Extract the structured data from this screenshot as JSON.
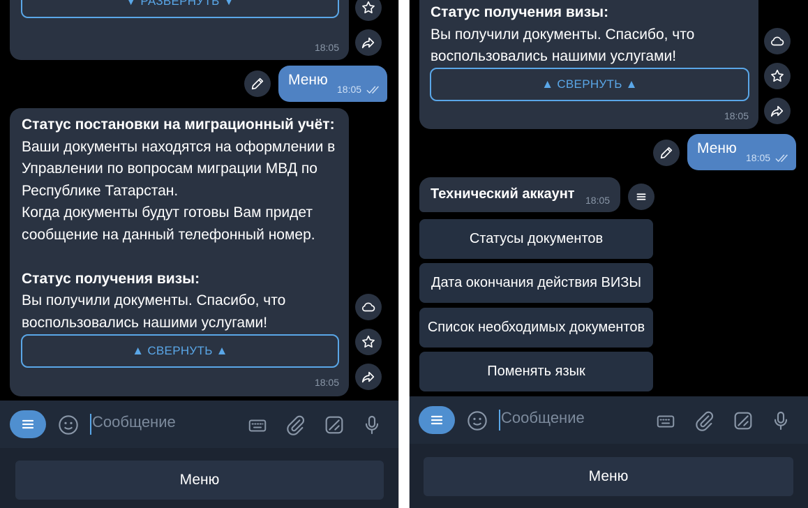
{
  "left": {
    "top_bubble": {
      "expand_label": "▼ РАЗВЕРНУТЬ ▼",
      "time": "18:05"
    },
    "user_msg": {
      "text": "Меню",
      "time": "18:05"
    },
    "status_bubble": {
      "migration_title": "Статус постановки на миграционный учёт:",
      "migration_lines": [
        "Ваши документы находятся на оформлении в",
        "Управлении по вопросам миграции МВД по",
        "Республике Татарстан.",
        "Когда документы будут готовы Вам придет",
        "сообщение на данный телефонный номер."
      ],
      "visa_title": "Статус получения визы:",
      "visa_lines": [
        "Вы получили документы. Спасибо, что",
        "воспользовались нашими услугами!"
      ],
      "collapse_label": "▲ СВЕРНУТЬ ▲",
      "time": "18:05"
    },
    "input": {
      "placeholder": "Сообщение"
    },
    "menu_button": "Меню"
  },
  "right": {
    "status_bubble": {
      "visa_title": "Статус получения визы:",
      "visa_lines": [
        "Вы получили документы. Спасибо, что",
        "воспользовались нашими услугами!"
      ],
      "collapse_label": "▲ СВЕРНУТЬ ▲",
      "time": "18:05"
    },
    "user_msg": {
      "text": "Меню",
      "time": "18:05"
    },
    "bot_msg": {
      "text": "Технический аккаунт",
      "time": "18:05"
    },
    "keyboard": [
      "Статусы документов",
      "Дата окончания действия ВИЗЫ",
      "Список необходимых документов",
      "Поменять язык"
    ],
    "input": {
      "placeholder": "Сообщение"
    },
    "menu_button": "Меню"
  },
  "colors": {
    "background": "#000000",
    "bubble": "#2a3342",
    "outgoing": "#4f82c3",
    "accent": "#5aa7e8"
  }
}
